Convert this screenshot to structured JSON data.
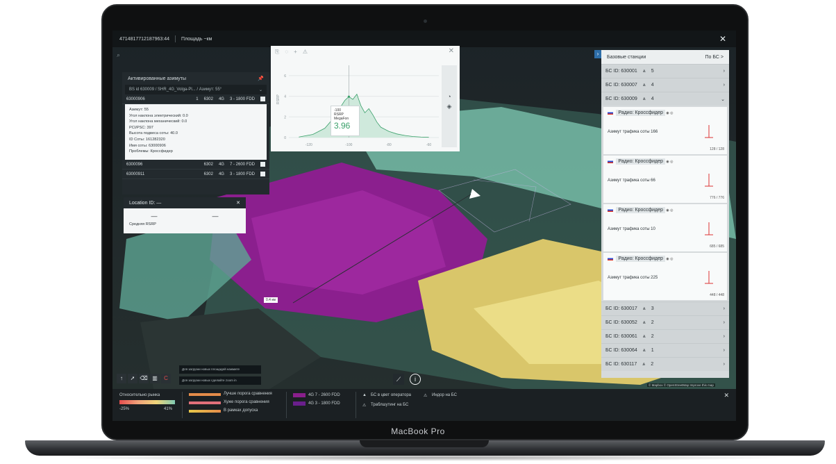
{
  "device": {
    "label": "MacBook Pro"
  },
  "topbar": {
    "id_text": "4714817712187963:44",
    "area_text": "Площадь ~км"
  },
  "azimuths": {
    "title": "Активированные азимуты",
    "selector": "BS id 630009 / SHR_4G_Volga-Pl... / Азимут: 55°",
    "rows": [
      {
        "cell": "63000906",
        "sector": "1",
        "pci": "6302",
        "tech": "4G",
        "band": "3 - 1800 FDD"
      },
      {
        "cell": "6300096",
        "sector": "",
        "pci": "6302",
        "tech": "4G",
        "band": "7 - 2600 FDD"
      },
      {
        "cell": "63000911",
        "sector": "",
        "pci": "6302",
        "tech": "4G",
        "band": "3 - 1800 FDD"
      }
    ],
    "info": [
      "Азимут: 55",
      "Угол наклона электрический: 0.0",
      "Угол наклона механический: 0.0",
      "PCI/PSC: 397",
      "Высота подвеса соты: 40.0",
      "ID Соты: 161282320",
      "Имя соты: 63000906",
      "Проблемы: Кроссфидер"
    ]
  },
  "location": {
    "title": "Location ID: —",
    "dash1": "—",
    "dash2": "—",
    "label": "Средняя RSRP"
  },
  "chart": {
    "yticks": [
      "6",
      "4",
      "2",
      "0"
    ],
    "xticks": [
      "-120",
      "-100",
      "-80",
      "-60"
    ],
    "ylabel": "RSRP",
    "tooltip": {
      "x": "-100",
      "label": "RSRP",
      "operator": "MegaFon",
      "value": "3.96"
    }
  },
  "chart_data": {
    "type": "area",
    "x": [
      -125,
      -118,
      -112,
      -108,
      -104,
      -102,
      -100,
      -98,
      -96,
      -94,
      -92,
      -90,
      -88,
      -86,
      -84,
      -80,
      -76,
      -72,
      -68,
      -64,
      -60
    ],
    "y": [
      0.05,
      0.3,
      0.9,
      1.8,
      3.0,
      3.6,
      3.96,
      3.7,
      4.2,
      3.1,
      2.4,
      2.8,
      2.2,
      1.5,
      1.0,
      0.6,
      0.35,
      0.2,
      0.1,
      0.05,
      0.02
    ],
    "ylim": [
      0,
      7
    ],
    "xlim": [
      -130,
      -55
    ]
  },
  "base_stations": {
    "title": "Базовые станции",
    "link": "По БС >",
    "top": [
      {
        "id": "БС ID: 630001",
        "count": "5",
        "icon": "chevron-right"
      },
      {
        "id": "БС ID: 630007",
        "count": "4",
        "icon": "chevron-right"
      },
      {
        "id": "БС ID: 630009",
        "count": "4",
        "icon": "chevron-down"
      }
    ],
    "cards": [
      {
        "title": "Радио: Кроссфидер",
        "azimuth": "Азимут трафика соты 166",
        "count": "128 / 128"
      },
      {
        "title": "Радио: Кроссфидер",
        "azimuth": "Азимут трафика соты 66",
        "count": "776 / 776"
      },
      {
        "title": "Радио: Кроссфидер",
        "azimuth": "Азимут трафика соты 10",
        "count": "685 / 685"
      },
      {
        "title": "Радио: Кроссфидер",
        "azimuth": "Азимут трафика соты 225",
        "count": "448 / 448"
      }
    ],
    "bottom": [
      {
        "id": "БС ID: 630017",
        "count": "3"
      },
      {
        "id": "БС ID: 630052",
        "count": "2"
      },
      {
        "id": "БС ID: 630061",
        "count": "2"
      },
      {
        "id": "БС ID: 630064",
        "count": "1"
      },
      {
        "id": "БС ID: 630117",
        "count": "2"
      }
    ]
  },
  "legend": {
    "relative": "Относительно рынка",
    "range_min": "-25%",
    "range_max": "41%",
    "better": "Лучше порога сравнения",
    "worse": "Хуже порога сравнения",
    "within": "В рамках допуска",
    "band1": "4G 7 - 2600 FDD",
    "band2": "4G 3 - 1800 FDD",
    "bs_color": "БС в цвет оператора",
    "indoor": "Индор на БС",
    "troubleshoot": "Траблшутинг на БС"
  },
  "hints": {
    "load_new": "Для загрузки новых площадей нажмите",
    "zoom_in": "Для загрузки новых сделайте zoom in"
  },
  "distance": "0.4 км",
  "attribution": "© Mapbox © OpenStreetMap Improve this map",
  "colors": {
    "accent": "#2e6ea8",
    "magenta": "#8a1f8c",
    "teal": "#6fc7b0",
    "yellow": "#e3d27a"
  }
}
